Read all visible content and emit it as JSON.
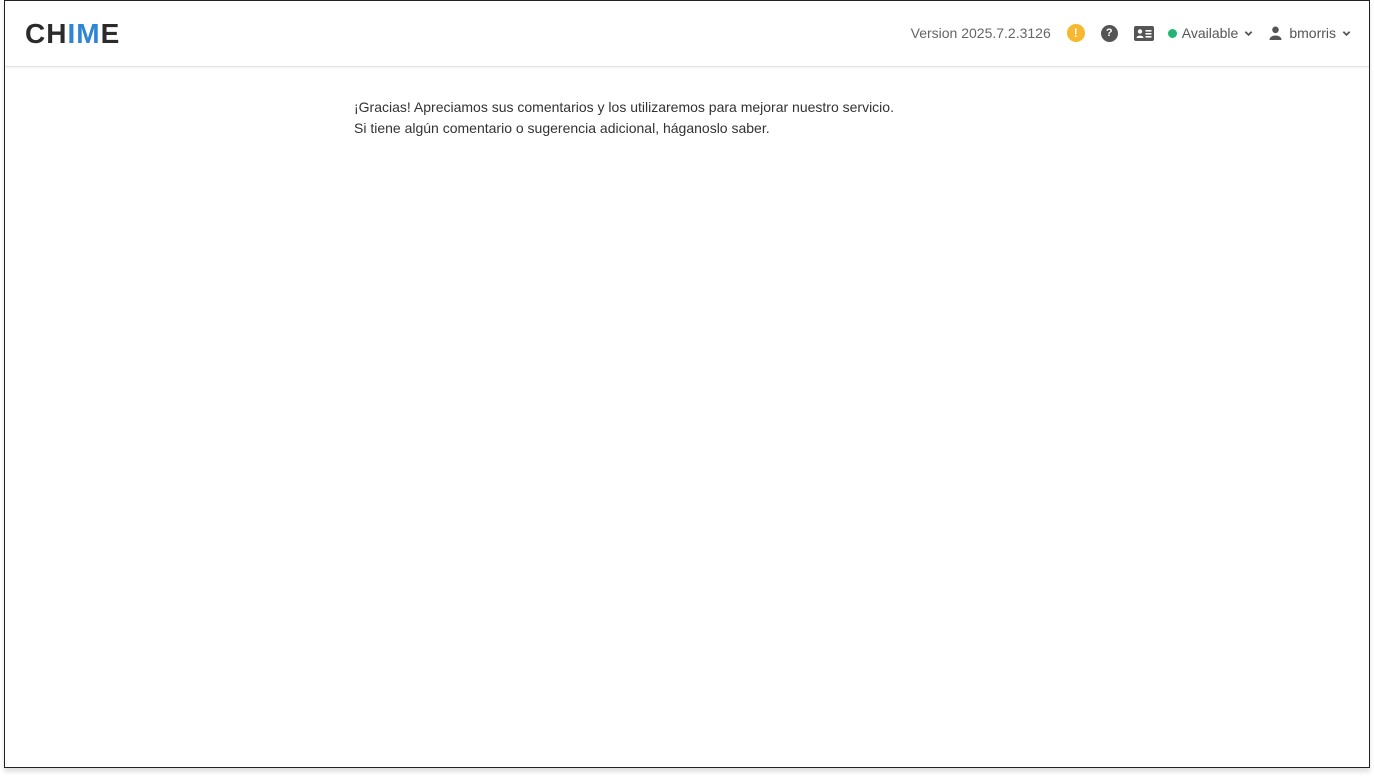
{
  "header": {
    "logo_part1": "CH",
    "logo_part2": "IM",
    "logo_part3": "E",
    "version": "Version 2025.7.2.3126",
    "alert_icon": "!",
    "help_icon": "?",
    "status_label": "Available",
    "username": "bmorris"
  },
  "main": {
    "line1": "¡Gracias! Apreciamos sus comentarios y los utilizaremos para mejorar nuestro servicio.",
    "line2": "Si tiene algún comentario o sugerencia adicional, háganoslo saber."
  },
  "colors": {
    "accent": "#2e86d3",
    "status_available": "#22b573",
    "alert": "#f5b82e"
  },
  "icons": [
    "alert-icon",
    "help-icon",
    "contact-card-icon",
    "chevron-down-icon",
    "user-icon"
  ]
}
